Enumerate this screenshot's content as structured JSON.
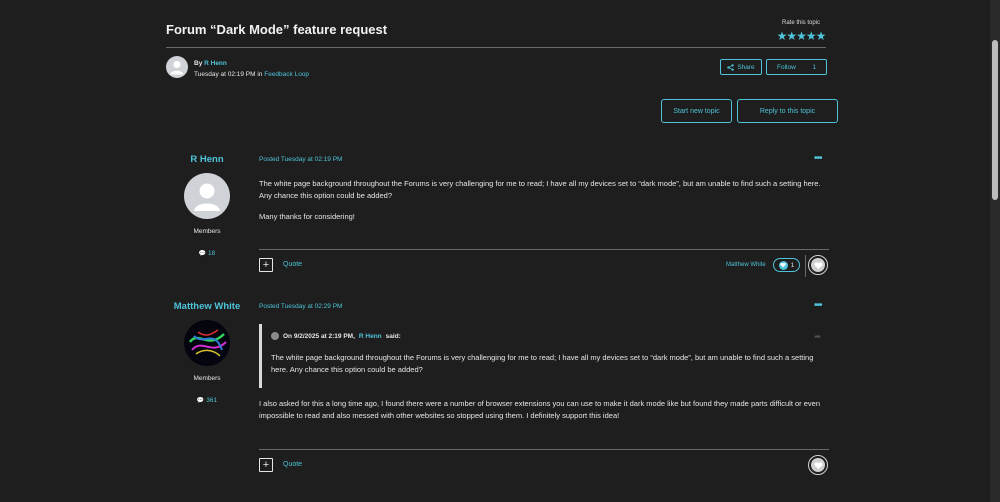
{
  "topic": {
    "title": "Forum “Dark Mode” feature request",
    "rate_label": "Rate this topic",
    "stars": "★★★★★",
    "by_label": "By",
    "author": "R Henn",
    "date": "Tuesday at 02:19 PM",
    "in_label": "in",
    "forum": "Feedback Loop"
  },
  "buttons": {
    "share": "Share",
    "follow": "Follow",
    "follow_count": "1",
    "start_new_topic": "Start new topic",
    "reply_to_topic": "Reply to this topic"
  },
  "posts": [
    {
      "author": "R Henn",
      "group": "Members",
      "post_count": "18",
      "posted": "Posted Tuesday at 02:19 PM",
      "paragraphs": [
        "The white page background throughout the Forums is very challenging for me to read; I have all my devices set to “dark mode”, but am unable to find such a setting here. Any chance this option could be added?",
        "Many thanks for considering!"
      ],
      "quote_label": "Quote",
      "reaction_user": "Matthew White",
      "reaction_count": "1"
    },
    {
      "author": "Matthew White",
      "group": "Members",
      "post_count": "361",
      "posted": "Posted Tuesday at 02:29 PM",
      "quote_header_prefix": "On 9/2/2025 at 2:19 PM,",
      "quote_header_author": "R Henn",
      "quote_header_suffix": "said:",
      "quote_text": "The white page background throughout the Forums is very challenging for me to read; I have all my devices set to “dark mode”, but am unable to find such a setting here. Any chance this option could be added?",
      "paragraphs": [
        "I also asked for this a long time ago, I found there were a number of browser extensions you can use to make it dark mode like but found they made parts difficult or even impossible to read and also messed with other websites so stopped using them. I definitely support this idea!"
      ],
      "quote_label": "Quote"
    }
  ],
  "icons": {
    "more": "•••",
    "plus": "+",
    "comment": "💬"
  },
  "colors": {
    "background": "#1e1e1e",
    "accent": "#4fc3d9",
    "text": "#e6e6e6"
  }
}
